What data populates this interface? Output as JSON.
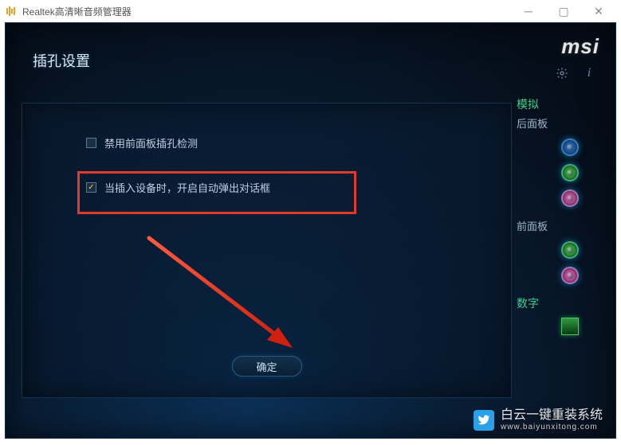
{
  "titlebar": {
    "title": "Realtek高清晰音频管理器"
  },
  "brand": "msi",
  "dialog": {
    "title": "插孔设置",
    "option1": {
      "label": "禁用前面板插孔检测",
      "checked": false
    },
    "option2": {
      "label": "当插入设备时，开启自动弹出对话框",
      "checked": true
    },
    "ok_label": "确定"
  },
  "sidebar": {
    "analog_title": "模拟",
    "rear_label": "后面板",
    "front_label": "前面板",
    "digital_title": "数字",
    "rear_jacks": [
      {
        "color": "blue"
      },
      {
        "color": "green"
      },
      {
        "color": "pink"
      }
    ],
    "front_jacks": [
      {
        "color": "dgreen"
      },
      {
        "color": "dpink"
      }
    ]
  },
  "watermark": {
    "text": "白云一键重装系统",
    "url": "www.baiyunxitong.com"
  },
  "colors": {
    "highlight": "#e03a2a",
    "accent_green": "#3fd08a"
  }
}
